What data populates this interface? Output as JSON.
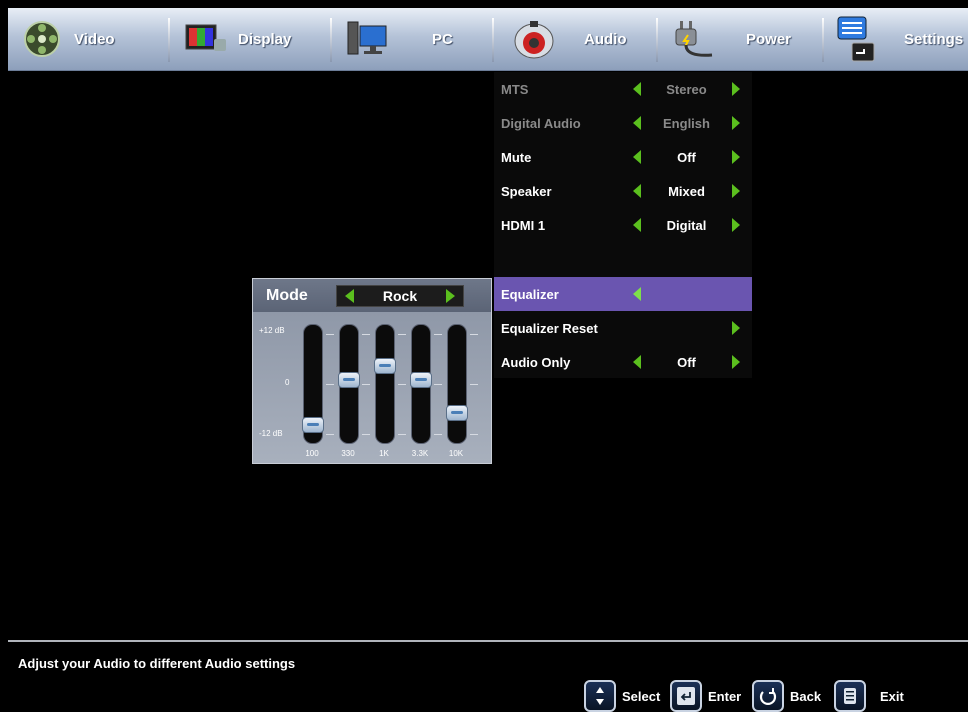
{
  "tabs": [
    {
      "label": "Video",
      "icon": "film-reel-icon"
    },
    {
      "label": "Display",
      "icon": "display-icon"
    },
    {
      "label": "PC",
      "icon": "pc-monitor-icon"
    },
    {
      "label": "Audio",
      "icon": "speaker-icon"
    },
    {
      "label": "Power",
      "icon": "power-plug-icon"
    },
    {
      "label": "Settings",
      "icon": "settings-menu-icon"
    }
  ],
  "active_tab": "Audio",
  "menu": {
    "items": [
      {
        "label": "MTS",
        "value": "Stereo",
        "enabled": false
      },
      {
        "label": "Digital Audio",
        "value": "English",
        "enabled": false
      },
      {
        "label": "Mute",
        "value": "Off",
        "enabled": true
      },
      {
        "label": "Speaker",
        "value": "Mixed",
        "enabled": true
      },
      {
        "label": "HDMI 1",
        "value": "Digital",
        "enabled": true
      },
      {
        "label": "Equalizer",
        "value": "",
        "enabled": true,
        "selected": true
      },
      {
        "label": "Equalizer Reset",
        "value": "",
        "enabled": true
      },
      {
        "label": "Audio Only",
        "value": "Off",
        "enabled": true
      }
    ]
  },
  "equalizer": {
    "mode_label": "Mode",
    "mode_value": "Rock",
    "db_labels": {
      "top": "+12 dB",
      "mid": "0",
      "bottom": "-12 dB"
    },
    "bands": [
      {
        "freq": "100",
        "level": 0.12
      },
      {
        "freq": "330",
        "level": 0.55
      },
      {
        "freq": "1K",
        "level": 0.68
      },
      {
        "freq": "3.3K",
        "level": 0.55
      },
      {
        "freq": "10K",
        "level": 0.23
      }
    ]
  },
  "status": {
    "description": "Adjust your Audio to different Audio settings",
    "hints": [
      {
        "label": "Select",
        "icon": "select-arrows-icon"
      },
      {
        "label": "Enter",
        "icon": "enter-key-icon"
      },
      {
        "label": "Back",
        "icon": "back-return-icon"
      },
      {
        "label": "Exit",
        "icon": "exit-icon"
      }
    ]
  },
  "colors": {
    "selected_highlight": "#6a55b0",
    "arrow_green": "#5bbf1e",
    "tab_bar": "#b5c3d8"
  }
}
